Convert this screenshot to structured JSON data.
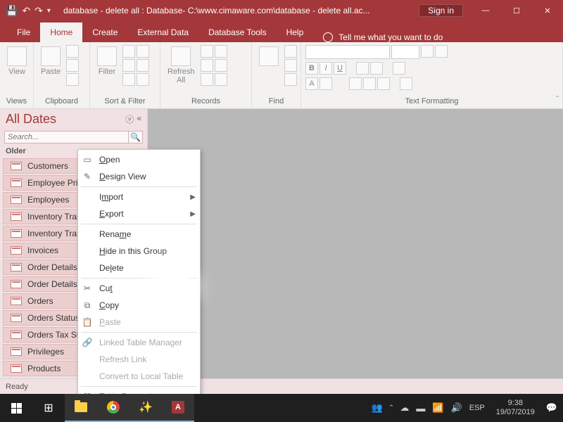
{
  "titlebar": {
    "title": "database - delete all : Database- C:\\www.cimaware.com\\database - delete all.ac...",
    "signin": "Sign in"
  },
  "tabs": {
    "file": "File",
    "home": "Home",
    "create": "Create",
    "external": "External Data",
    "dbtools": "Database Tools",
    "help": "Help",
    "tellme": "Tell me what you want to do"
  },
  "ribbon": {
    "views": {
      "label": "Views",
      "view": "View"
    },
    "clipboard": {
      "label": "Clipboard",
      "paste": "Paste"
    },
    "sortfilter": {
      "label": "Sort & Filter",
      "filter": "Filter"
    },
    "records": {
      "label": "Records",
      "refresh": "Refresh\nAll"
    },
    "find": {
      "label": "Find"
    },
    "textfmt": {
      "label": "Text Formatting"
    }
  },
  "nav": {
    "header": "All Dates",
    "search_placeholder": "Search...",
    "group": "Older",
    "items": [
      "Customers",
      "Employee Privileges",
      "Employees",
      "Inventory Transaction Types",
      "Inventory Transactions",
      "Invoices",
      "Order Details",
      "Order Details Status",
      "Orders",
      "Orders Status",
      "Orders Tax Status",
      "Privileges",
      "Products"
    ]
  },
  "context": {
    "open": "Open",
    "design": "Design View",
    "import": "Import",
    "export": "Export",
    "rename": "Rename",
    "hide": "Hide in this Group",
    "delete": "Delete",
    "cut": "Cut",
    "copy": "Copy",
    "paste": "Paste",
    "linked": "Linked Table Manager",
    "refresh": "Refresh Link",
    "convert": "Convert to Local Table",
    "props": "Table Properties"
  },
  "status": {
    "ready": "Ready"
  },
  "taskbar": {
    "lang": "ESP",
    "time": "9:38",
    "date": "19/07/2019"
  }
}
